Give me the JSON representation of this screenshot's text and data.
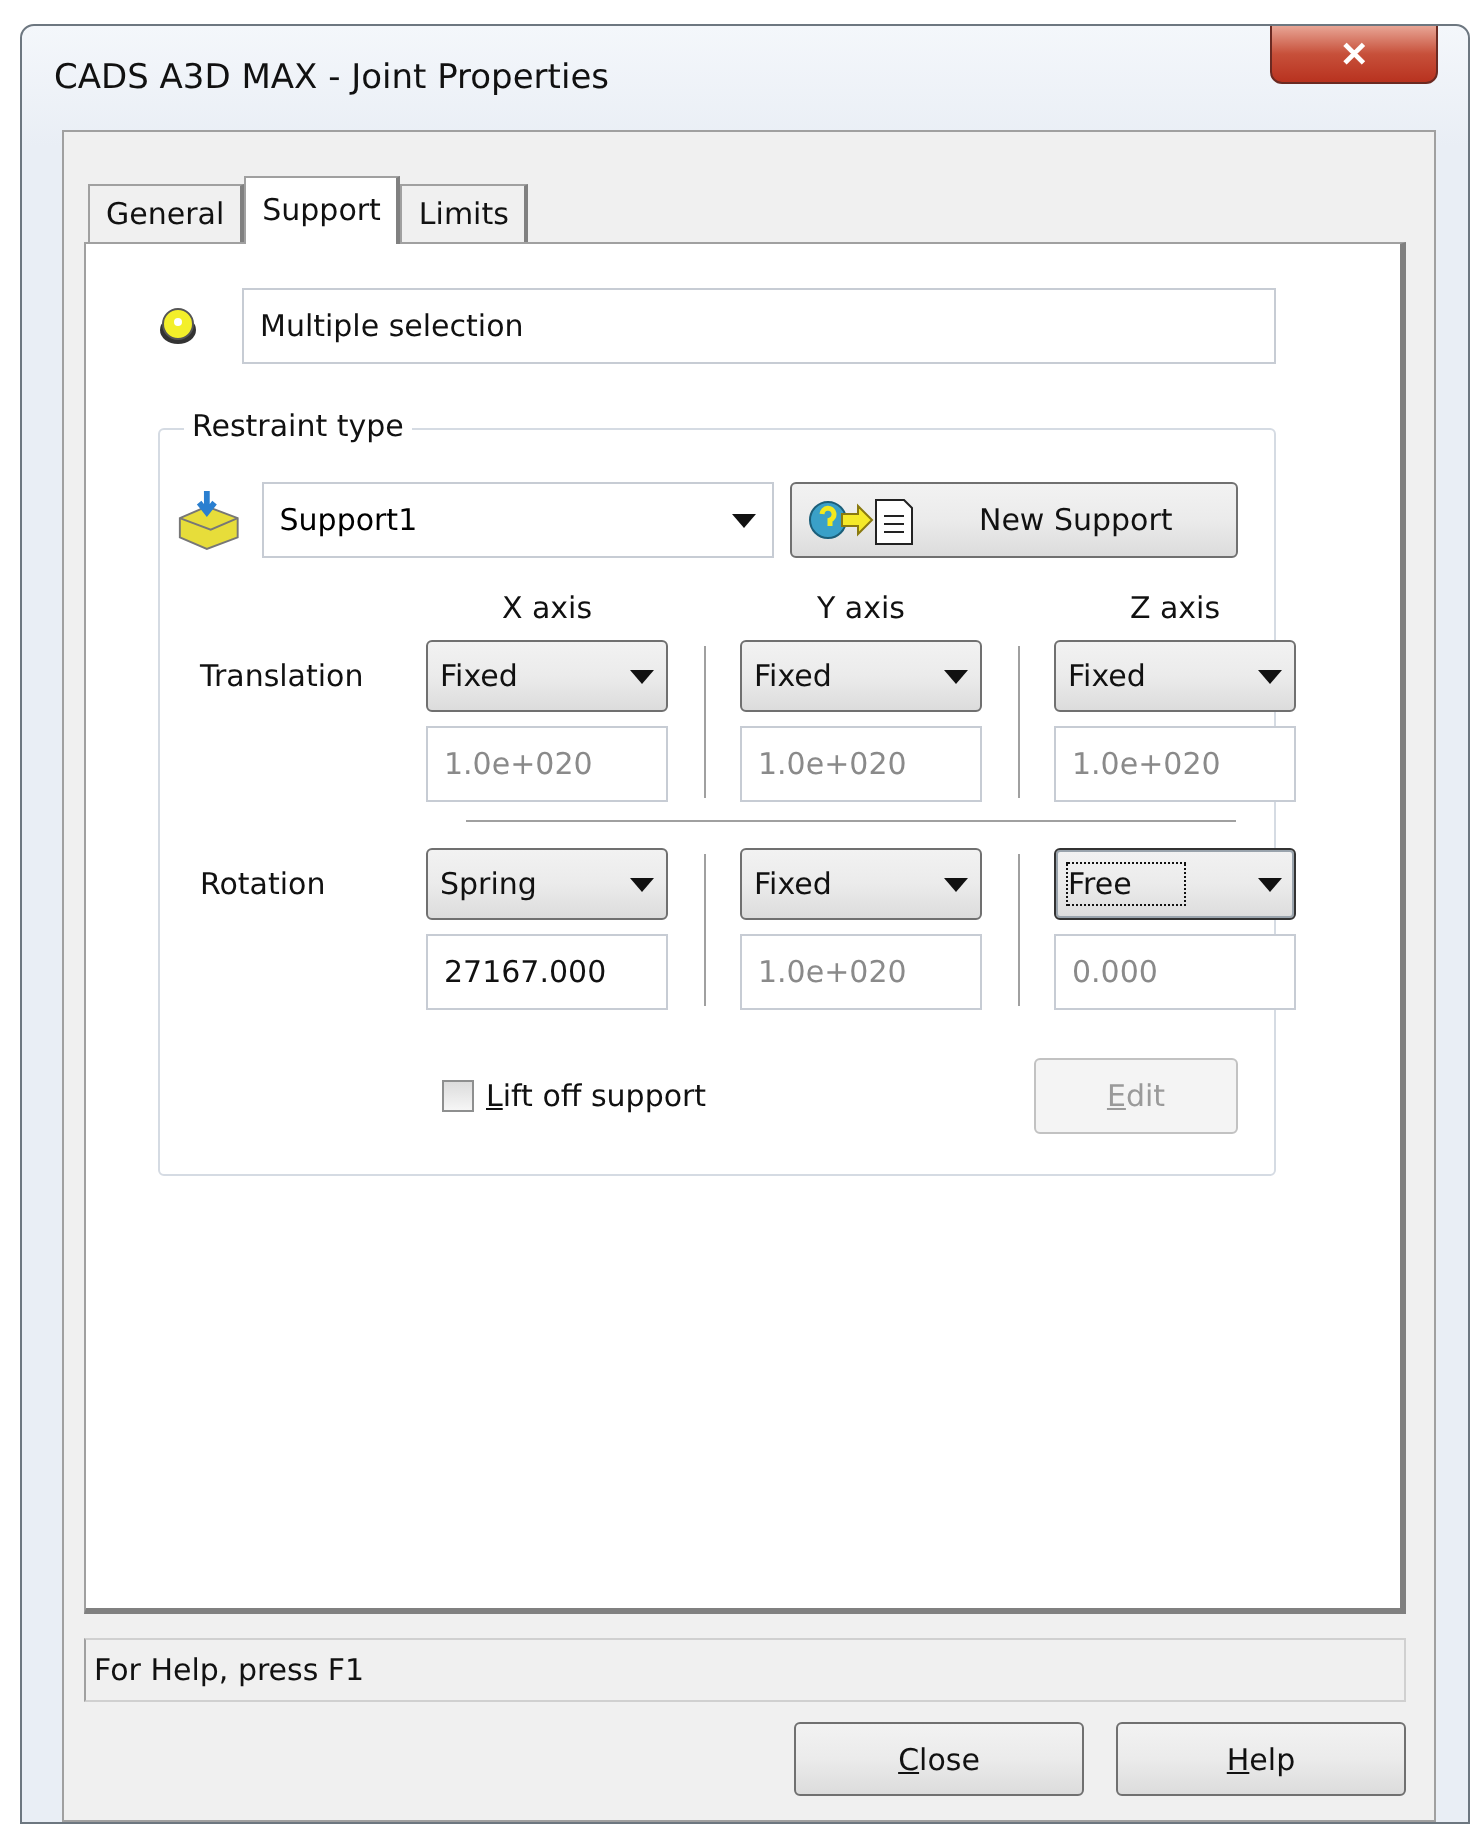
{
  "window": {
    "title": "CADS A3D MAX - Joint Properties",
    "close": "✕"
  },
  "tabs": [
    {
      "label": "General",
      "selected": false
    },
    {
      "label": "Support",
      "selected": true
    },
    {
      "label": "Limits",
      "selected": false
    }
  ],
  "selection_field": {
    "value": "Multiple selection"
  },
  "restraint_group": {
    "title": "Restraint type",
    "support_combo": {
      "value": "Support1"
    },
    "new_support_button": {
      "label": "New Support"
    }
  },
  "axes": [
    "X axis",
    "Y axis",
    "Z axis"
  ],
  "rows": [
    {
      "label": "Translation",
      "cells": [
        {
          "choice": "Fixed",
          "focused": false,
          "value": "1.0e+020",
          "disabled": true
        },
        {
          "choice": "Fixed",
          "focused": false,
          "value": "1.0e+020",
          "disabled": true
        },
        {
          "choice": "Fixed",
          "focused": false,
          "value": "1.0e+020",
          "disabled": true
        }
      ]
    },
    {
      "label": "Rotation",
      "cells": [
        {
          "choice": "Spring",
          "focused": false,
          "value": "27167.000",
          "disabled": false
        },
        {
          "choice": "Fixed",
          "focused": false,
          "value": "1.0e+020",
          "disabled": true
        },
        {
          "choice": "Free",
          "focused": true,
          "value": "0.000",
          "disabled": true
        }
      ]
    }
  ],
  "lift_off": {
    "label": "Lift off support",
    "first_letter_underlined": true,
    "checked": false
  },
  "edit_button": {
    "label": "Edit",
    "first_letter_underlined": true,
    "disabled": true
  },
  "status_bar": "For Help, press F1",
  "buttons": [
    {
      "label": "Close",
      "first_letter_underlined": true
    },
    {
      "label": "Help",
      "first_letter_underlined": true
    }
  ]
}
